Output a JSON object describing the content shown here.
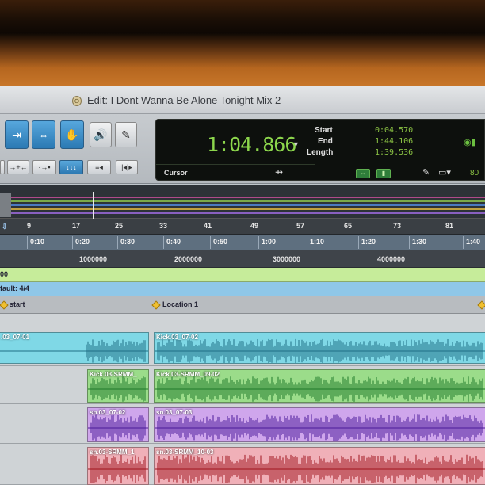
{
  "window": {
    "title": "Edit: I Dont Wanna Be Alone Tonight Mix 2"
  },
  "counter": {
    "main_time": "1:04.866",
    "cursor_label": "Cursor",
    "start_label": "Start",
    "end_label": "End",
    "length_label": "Length",
    "start_value": "0:04.570",
    "end_value": "1:44.106",
    "length_value": "1:39.536",
    "nudge_value": "80"
  },
  "ruler": {
    "bars": [
      "9",
      "17",
      "25",
      "33",
      "41",
      "49",
      "57",
      "65",
      "73",
      "81"
    ],
    "times": [
      "0:10",
      "0:20",
      "0:30",
      "0:40",
      "0:50",
      "1:00",
      "1:10",
      "1:20",
      "1:30",
      "1:40"
    ],
    "samples": [
      "1000000",
      "2000000",
      "3000000",
      "4000000"
    ]
  },
  "tempo": {
    "value": "00"
  },
  "meter": {
    "label": "fault: 4/4"
  },
  "markers": [
    {
      "label": "start"
    },
    {
      "label": "Location 1"
    }
  ],
  "tracks": [
    {
      "color": "#7fd8e6",
      "wave_color": "#1f6f86",
      "clips": [
        {
          "name": ".03_07-01"
        },
        {
          "name": "Kick.03_07-02"
        }
      ]
    },
    {
      "color": "#9bdc8a",
      "wave_color": "#1f7a2a",
      "clips": [
        {
          "name": "Kick.03-SRMM_"
        },
        {
          "name": "Kick.03-SRMM_09-02"
        }
      ]
    },
    {
      "color": "#cfa6ec",
      "wave_color": "#4b1a9a",
      "clips": [
        {
          "name": "sn.03_07-02"
        },
        {
          "name": "sn.03_07-03"
        }
      ]
    },
    {
      "color": "#f0b0b8",
      "wave_color": "#a0141e",
      "clips": [
        {
          "name": "sn.03-SRMM_1"
        },
        {
          "name": "sn.03-SRMM_10-03"
        }
      ]
    }
  ]
}
